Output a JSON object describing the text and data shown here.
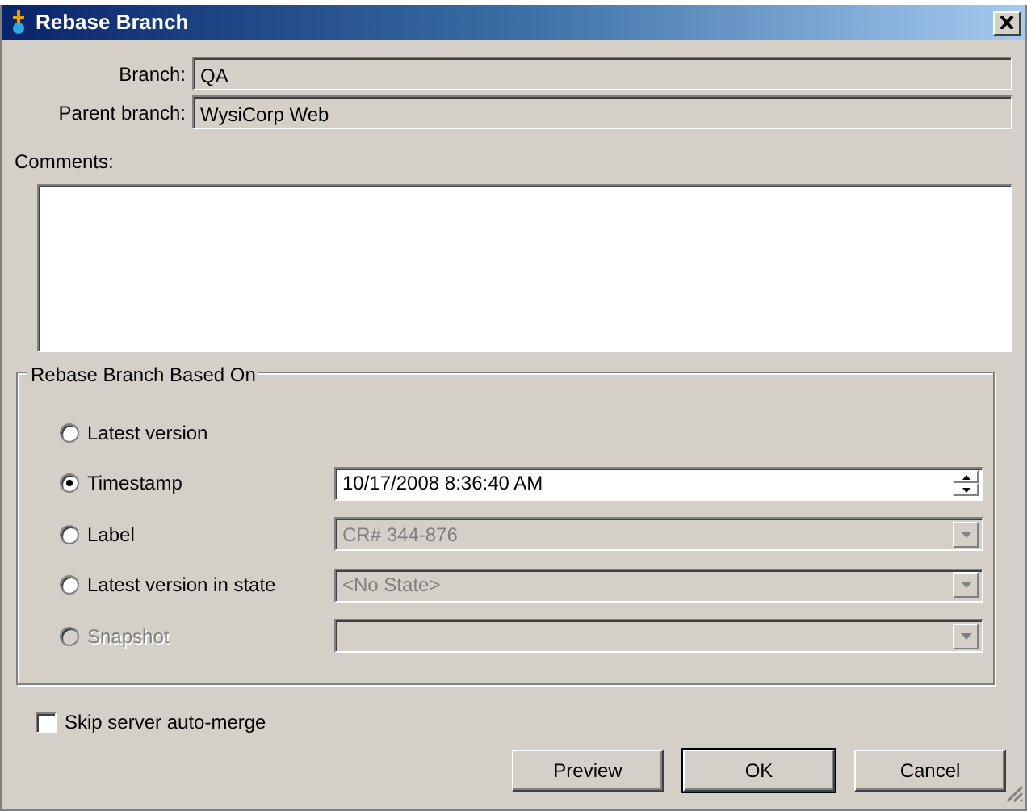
{
  "window": {
    "title": "Rebase Branch"
  },
  "fields": [
    {
      "label": "Branch:",
      "value": "QA"
    },
    {
      "label": "Parent branch:",
      "value": "WysiCorp Web"
    }
  ],
  "comments": {
    "label": "Comments:"
  },
  "group": {
    "title": "Rebase Branch Based On",
    "options": [
      {
        "label": "Latest version",
        "selected": false,
        "disabled": false,
        "kind": "none"
      },
      {
        "label": "Timestamp",
        "selected": true,
        "disabled": false,
        "kind": "datetime",
        "value": "10/17/2008 8:36:40 AM",
        "control_disabled": false
      },
      {
        "label": "Label",
        "selected": false,
        "disabled": false,
        "kind": "combo",
        "value": "CR# 344-876",
        "control_disabled": true
      },
      {
        "label": "Latest version in state",
        "selected": false,
        "disabled": false,
        "kind": "combo",
        "value": "<No State>",
        "control_disabled": true
      },
      {
        "label": "Snapshot",
        "selected": false,
        "disabled": true,
        "kind": "combo",
        "control_disabled": true
      }
    ]
  },
  "skip_merge": {
    "label": "Skip server auto-merge",
    "checked": false
  },
  "buttons": [
    {
      "label": "Preview",
      "default": false
    },
    {
      "label": "OK",
      "default": true
    },
    {
      "label": "Cancel",
      "default": false
    }
  ]
}
